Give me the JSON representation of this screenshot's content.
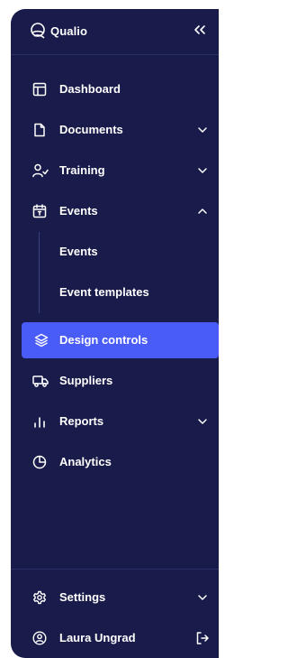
{
  "brand": {
    "name": "Qualio"
  },
  "nav": {
    "dashboard": "Dashboard",
    "documents": "Documents",
    "training": "Training",
    "events": "Events",
    "events_sub": [
      "Events",
      "Event templates"
    ],
    "design_controls": "Design controls",
    "suppliers": "Suppliers",
    "reports": "Reports",
    "analytics": "Analytics"
  },
  "footer": {
    "settings": "Settings",
    "user": "Laura Ungrad"
  },
  "colors": {
    "sidebar_bg": "#191b4a",
    "active_bg": "#4a5cf7",
    "text": "#ffffff"
  }
}
